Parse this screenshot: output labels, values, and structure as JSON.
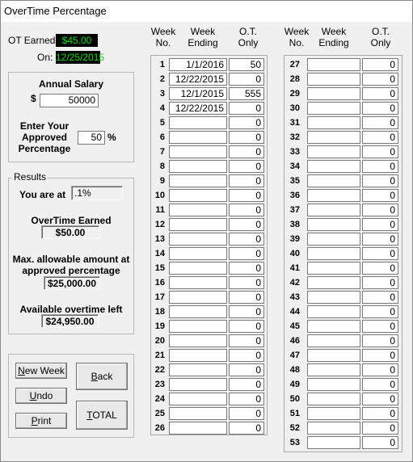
{
  "window": {
    "title": "OverTime Percentage"
  },
  "summary": {
    "ot_earned_label": "OT Earned:",
    "ot_earned_value": "$45.00",
    "on_label": "On:",
    "on_value": "12/25/2015"
  },
  "salary": {
    "title": "Annual Salary",
    "currency": "$",
    "value": "50000",
    "approved_label_1": "Enter Your",
    "approved_label_2": "Approved",
    "approved_label_3": "Percentage",
    "approved_value": "50",
    "percent_sign": "%"
  },
  "results": {
    "title": "Results",
    "you_are_at_label": "You are at",
    "you_are_at_value": ".1%",
    "overtime_earned_label": "OverTime Earned",
    "overtime_earned_value": "$50.00",
    "max_label_1": "Max. allowable amount at",
    "max_label_2": "approved percentage",
    "max_value": "$25,000.00",
    "available_label": "Available overtime left",
    "available_value": "$24,950.00"
  },
  "buttons": {
    "new_week": {
      "first": "N",
      "rest": "ew Week"
    },
    "back": {
      "first": "B",
      "rest": "ack"
    },
    "undo": {
      "first": "U",
      "rest": "ndo"
    },
    "print": {
      "first": "P",
      "rest": "rint"
    },
    "total": {
      "first": "T",
      "rest": "OTAL"
    }
  },
  "table": {
    "headers": {
      "week_no_1": "Week",
      "week_no_2": "No.",
      "ending_1": "Week",
      "ending_2": "Ending",
      "ot_1": "O.T.",
      "ot_2": "Only"
    },
    "left_rows": [
      {
        "no": "1",
        "ending": "1/1/2016",
        "ot": "50"
      },
      {
        "no": "2",
        "ending": "12/22/2015",
        "ot": "0"
      },
      {
        "no": "3",
        "ending": "12/1/2015",
        "ot": "555"
      },
      {
        "no": "4",
        "ending": "12/22/2015",
        "ot": "0"
      },
      {
        "no": "5",
        "ending": "",
        "ot": "0"
      },
      {
        "no": "6",
        "ending": "",
        "ot": "0"
      },
      {
        "no": "7",
        "ending": "",
        "ot": "0"
      },
      {
        "no": "8",
        "ending": "",
        "ot": "0"
      },
      {
        "no": "9",
        "ending": "",
        "ot": "0"
      },
      {
        "no": "10",
        "ending": "",
        "ot": "0"
      },
      {
        "no": "11",
        "ending": "",
        "ot": "0"
      },
      {
        "no": "12",
        "ending": "",
        "ot": "0"
      },
      {
        "no": "13",
        "ending": "",
        "ot": "0"
      },
      {
        "no": "14",
        "ending": "",
        "ot": "0"
      },
      {
        "no": "15",
        "ending": "",
        "ot": "0"
      },
      {
        "no": "16",
        "ending": "",
        "ot": "0"
      },
      {
        "no": "17",
        "ending": "",
        "ot": "0"
      },
      {
        "no": "18",
        "ending": "",
        "ot": "0"
      },
      {
        "no": "19",
        "ending": "",
        "ot": "0"
      },
      {
        "no": "20",
        "ending": "",
        "ot": "0"
      },
      {
        "no": "21",
        "ending": "",
        "ot": "0"
      },
      {
        "no": "22",
        "ending": "",
        "ot": "0"
      },
      {
        "no": "23",
        "ending": "",
        "ot": "0"
      },
      {
        "no": "24",
        "ending": "",
        "ot": "0"
      },
      {
        "no": "25",
        "ending": "",
        "ot": "0"
      },
      {
        "no": "26",
        "ending": "",
        "ot": "0"
      }
    ],
    "right_rows": [
      {
        "no": "27",
        "ending": "",
        "ot": "0"
      },
      {
        "no": "28",
        "ending": "",
        "ot": "0"
      },
      {
        "no": "29",
        "ending": "",
        "ot": "0"
      },
      {
        "no": "30",
        "ending": "",
        "ot": "0"
      },
      {
        "no": "31",
        "ending": "",
        "ot": "0"
      },
      {
        "no": "32",
        "ending": "",
        "ot": "0"
      },
      {
        "no": "33",
        "ending": "",
        "ot": "0"
      },
      {
        "no": "34",
        "ending": "",
        "ot": "0"
      },
      {
        "no": "35",
        "ending": "",
        "ot": "0"
      },
      {
        "no": "36",
        "ending": "",
        "ot": "0"
      },
      {
        "no": "37",
        "ending": "",
        "ot": "0"
      },
      {
        "no": "38",
        "ending": "",
        "ot": "0"
      },
      {
        "no": "39",
        "ending": "",
        "ot": "0"
      },
      {
        "no": "40",
        "ending": "",
        "ot": "0"
      },
      {
        "no": "41",
        "ending": "",
        "ot": "0"
      },
      {
        "no": "42",
        "ending": "",
        "ot": "0"
      },
      {
        "no": "43",
        "ending": "",
        "ot": "0"
      },
      {
        "no": "44",
        "ending": "",
        "ot": "0"
      },
      {
        "no": "45",
        "ending": "",
        "ot": "0"
      },
      {
        "no": "46",
        "ending": "",
        "ot": "0"
      },
      {
        "no": "47",
        "ending": "",
        "ot": "0"
      },
      {
        "no": "48",
        "ending": "",
        "ot": "0"
      },
      {
        "no": "49",
        "ending": "",
        "ot": "0"
      },
      {
        "no": "50",
        "ending": "",
        "ot": "0"
      },
      {
        "no": "51",
        "ending": "",
        "ot": "0"
      },
      {
        "no": "52",
        "ending": "",
        "ot": "0"
      },
      {
        "no": "53",
        "ending": "",
        "ot": "0"
      }
    ]
  }
}
